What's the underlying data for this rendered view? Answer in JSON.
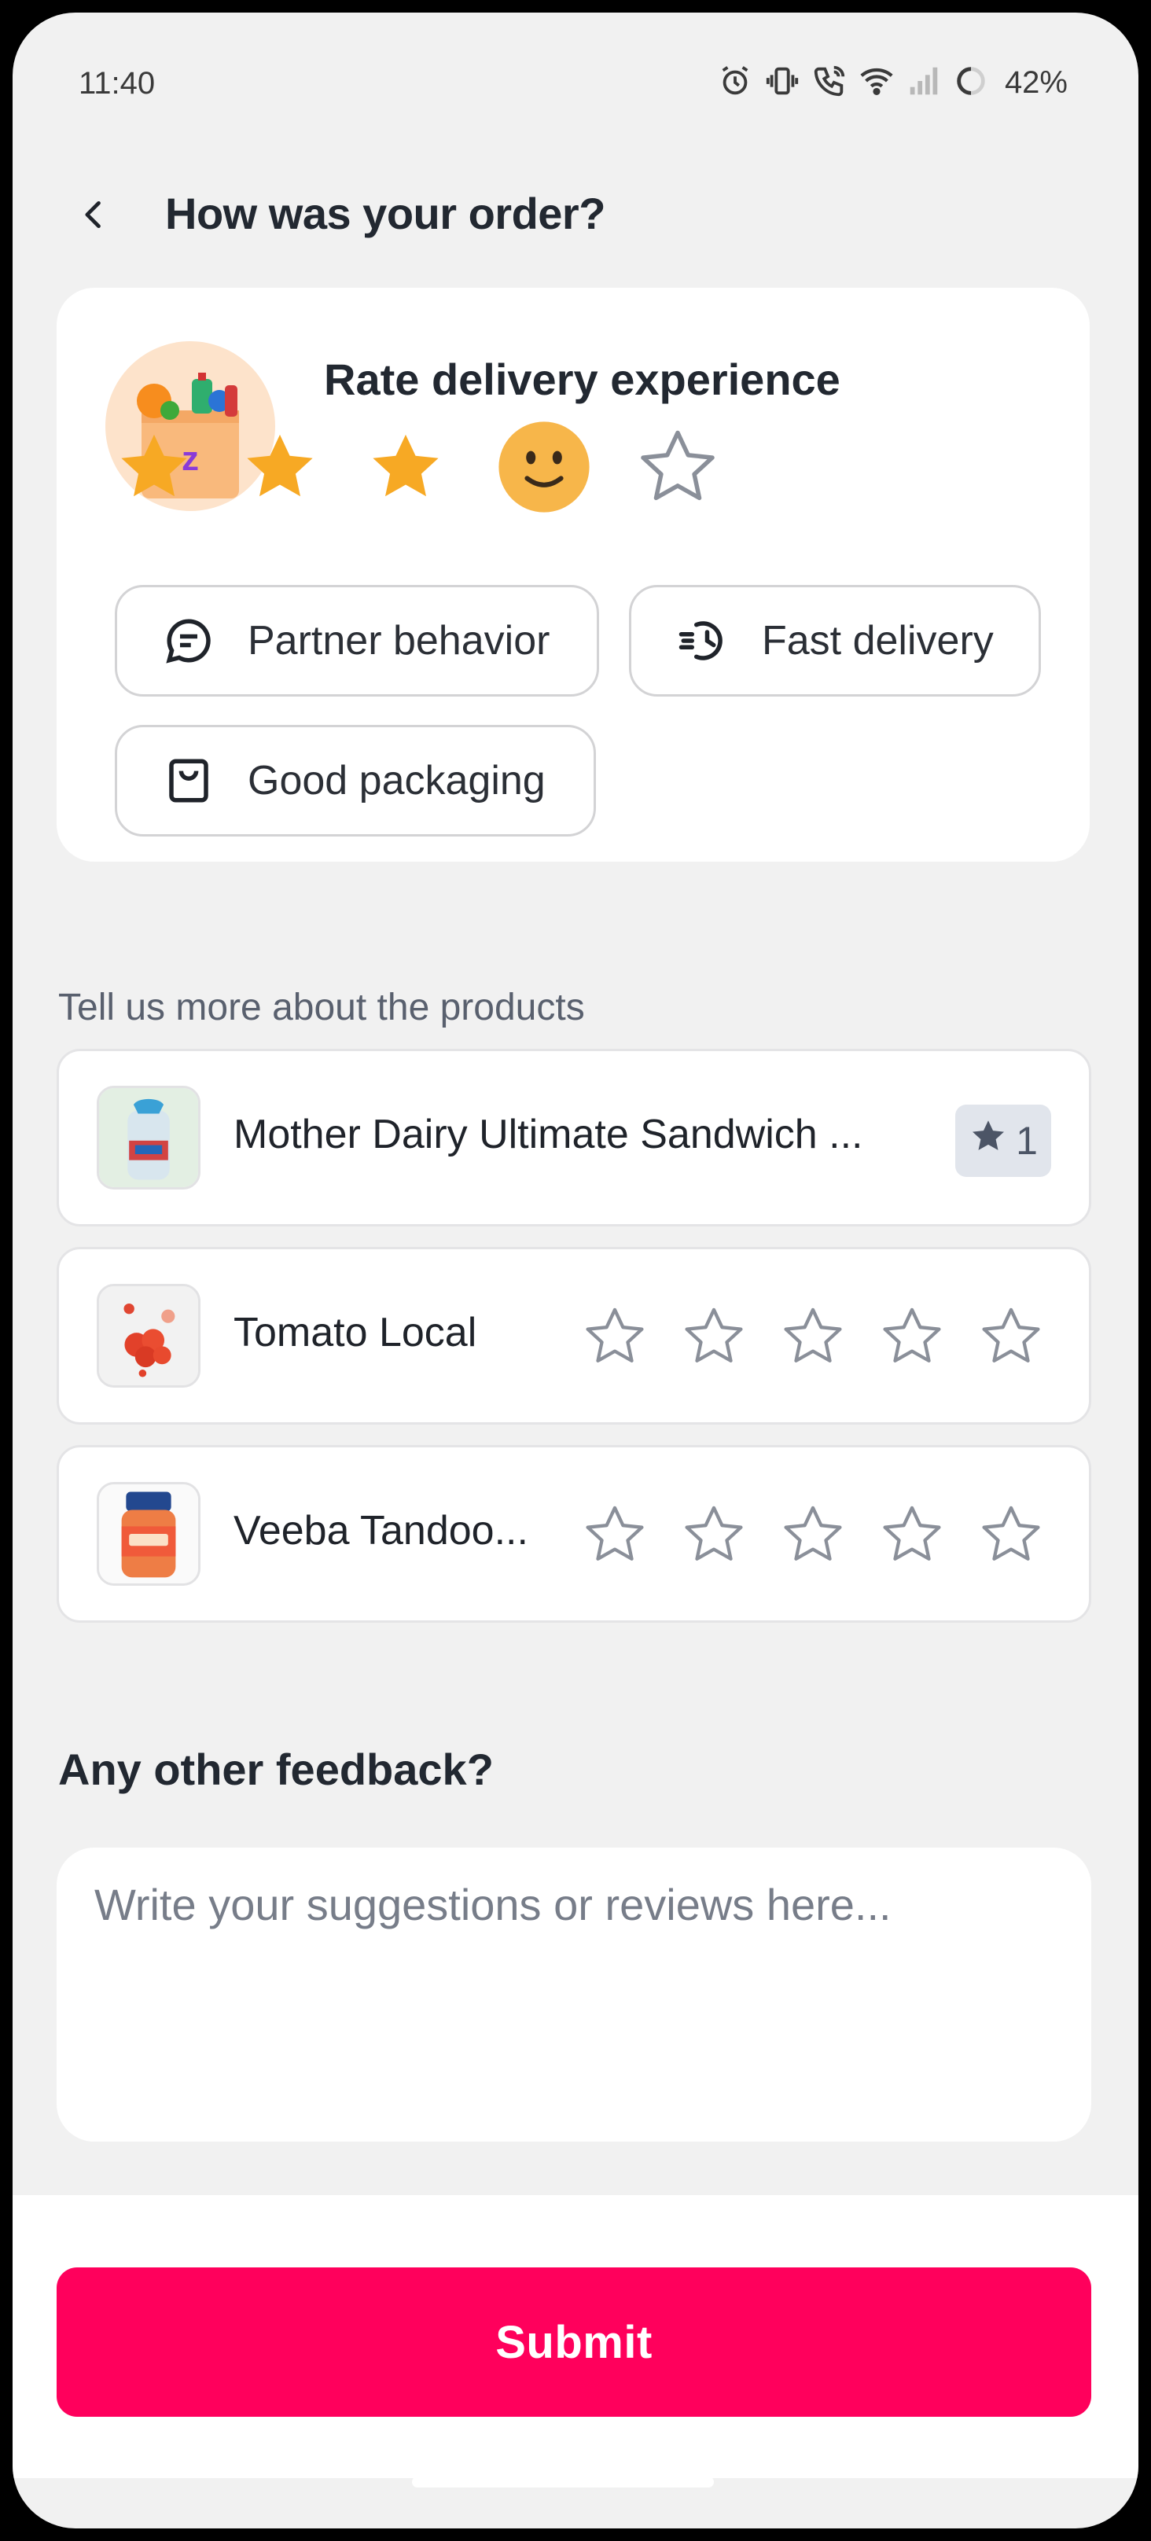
{
  "status_bar": {
    "time": "11:40",
    "battery": "42%",
    "icons": [
      "alarm-icon",
      "vibrate-icon",
      "wifi-call-icon",
      "wifi-icon",
      "signal-icon",
      "battery-icon"
    ]
  },
  "header": {
    "title": "How was your order?",
    "back_icon": "chevron-left-icon"
  },
  "delivery": {
    "title": "Rate delivery experience",
    "rating": 4,
    "max_rating": 5,
    "tags": [
      {
        "label": "Partner behavior",
        "icon": "chat-bubble-icon"
      },
      {
        "label": "Fast delivery",
        "icon": "fast-clock-icon"
      },
      {
        "label": "Good packaging",
        "icon": "bag-icon"
      }
    ]
  },
  "products_section": {
    "label": "Tell us more about the products",
    "items": [
      {
        "name": "Mother Dairy Ultimate Sandwich ...",
        "rating": 1,
        "rating_label": "1"
      },
      {
        "name": "Tomato Local",
        "rating": 0
      },
      {
        "name": "Veeba Tandoo...",
        "rating": 0
      }
    ]
  },
  "feedback": {
    "title": "Any other feedback?",
    "placeholder": "Write your suggestions or reviews here...",
    "value": ""
  },
  "submit": {
    "label": "Submit"
  },
  "colors": {
    "accent": "#ff005c",
    "star_filled": "#f7a924",
    "star_empty_stroke": "#8a8f99",
    "badge_bg": "#e1e5ec",
    "page_bg": "#f1f1f1"
  }
}
